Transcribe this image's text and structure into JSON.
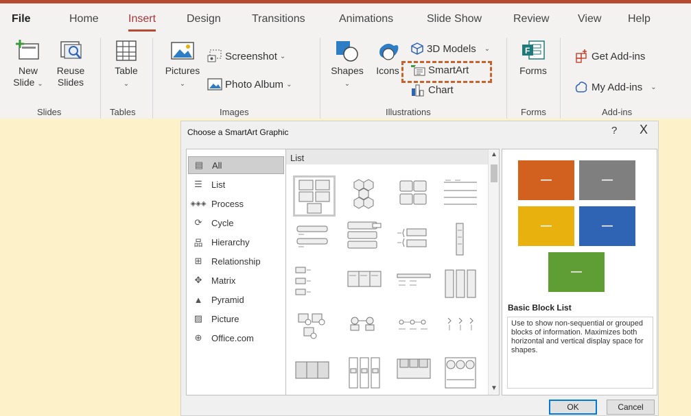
{
  "ribbon": {
    "tabs": [
      {
        "label": "File"
      },
      {
        "label": "Home"
      },
      {
        "label": "Insert"
      },
      {
        "label": "Design"
      },
      {
        "label": "Transitions"
      },
      {
        "label": "Animations"
      },
      {
        "label": "Slide Show"
      },
      {
        "label": "Review"
      },
      {
        "label": "View"
      },
      {
        "label": "Help"
      }
    ],
    "active_tab": "Insert",
    "accent_color": "#b64a31",
    "groups": {
      "slides": {
        "label": "Slides",
        "new_slide": "New\nSlide",
        "reuse_slides": "Reuse\nSlides"
      },
      "tables": {
        "label": "Tables",
        "table": "Table"
      },
      "images": {
        "label": "Images",
        "pictures": "Pictures",
        "screenshot": "Screenshot",
        "photo_album": "Photo Album"
      },
      "illustrations": {
        "label": "Illustrations",
        "shapes": "Shapes",
        "icons": "Icons",
        "models_3d": "3D Models",
        "smartart": "SmartArt",
        "chart": "Chart"
      },
      "forms": {
        "label": "Forms",
        "forms": "Forms"
      },
      "addins": {
        "label": "Add-ins",
        "get_addins": "Get Add-ins",
        "my_addins": "My Add-ins"
      }
    }
  },
  "dialog": {
    "title": "Choose a SmartArt Graphic",
    "help": "?",
    "close": "X",
    "categories": [
      {
        "label": "All",
        "icon": "all-icon",
        "selected": true
      },
      {
        "label": "List",
        "icon": "list-icon"
      },
      {
        "label": "Process",
        "icon": "process-icon"
      },
      {
        "label": "Cycle",
        "icon": "cycle-icon"
      },
      {
        "label": "Hierarchy",
        "icon": "hierarchy-icon"
      },
      {
        "label": "Relationship",
        "icon": "relationship-icon"
      },
      {
        "label": "Matrix",
        "icon": "matrix-icon"
      },
      {
        "label": "Pyramid",
        "icon": "pyramid-icon"
      },
      {
        "label": "Picture",
        "icon": "picture-icon"
      },
      {
        "label": "Office.com",
        "icon": "globe-icon"
      }
    ],
    "gallery": {
      "header": "List"
    },
    "preview": {
      "name": "Basic Block List",
      "description": "Use to show non-sequential or grouped blocks of information. Maximizes both horizontal and vertical display space for shapes.",
      "box_colors": [
        "#d2611f",
        "#7f7f7f",
        "#e8b10d",
        "#2f63b4",
        "#5e9e34"
      ],
      "box_text": "—"
    },
    "ok_label": "OK",
    "cancel_label": "Cancel"
  }
}
